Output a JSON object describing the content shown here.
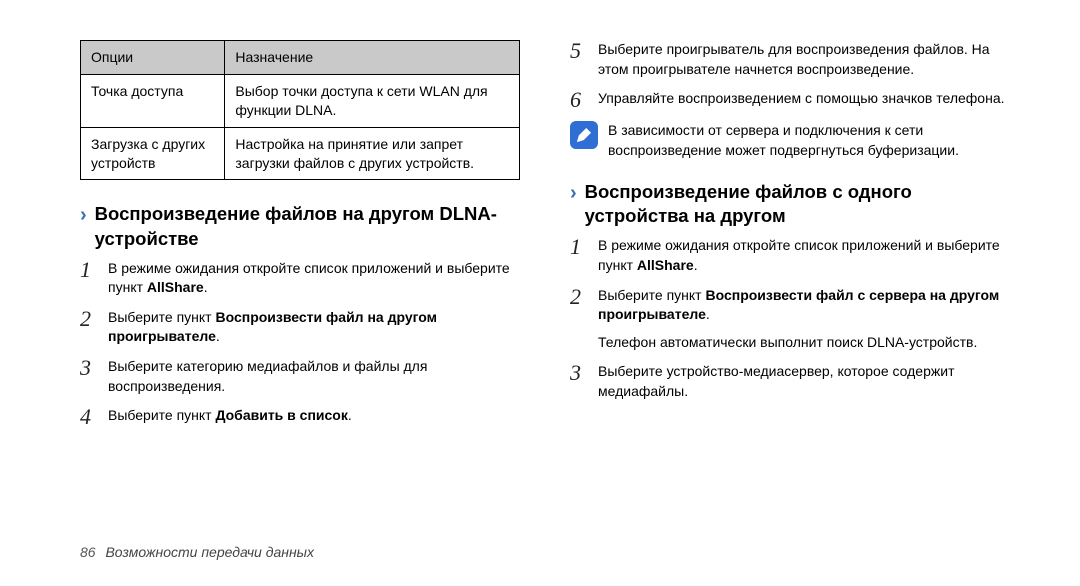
{
  "table": {
    "headers": {
      "opt": "Опции",
      "purpose": "Назначение"
    },
    "rows": [
      {
        "opt": "Точка доступа",
        "purpose": "Выбор точки доступа к сети WLAN для функции DLNA."
      },
      {
        "opt": "Загрузка с других устройств",
        "purpose": "Настройка на принятие или запрет загрузки файлов с других устройств."
      }
    ]
  },
  "left": {
    "heading": "Воспроизведение файлов на другом DLNA-устройстве",
    "steps": {
      "s1a": "В режиме ожидания откройте список приложений и выберите пункт ",
      "s1b": "AllShare",
      "s1c": ".",
      "s2a": "Выберите пункт ",
      "s2b": "Воспроизвести файл на другом проигрывателе",
      "s2c": ".",
      "s3": "Выберите категорию медиафайлов и файлы для воспроизведения.",
      "s4a": "Выберите пункт ",
      "s4b": "Добавить в список",
      "s4c": "."
    }
  },
  "right": {
    "s5": "Выберите проигрыватель для воспроизведения файлов. На этом проигрывателе начнется воспроизведение.",
    "s6": "Управляйте воспроизведением с помощью значков телефона.",
    "note": "В зависимости от сервера и подключения к сети воспроизведение может подвергнуться буферизации.",
    "heading": "Воспроизведение файлов с одного устройства на другом",
    "steps": {
      "s1a": "В режиме ожидания откройте список приложений и выберите пункт ",
      "s1b": "AllShare",
      "s1c": ".",
      "s2a": "Выберите пункт ",
      "s2b": "Воспроизвести файл с сервера на другом проигрывателе",
      "s2c": ".",
      "s2d": "Телефон автоматически выполнит поиск DLNA-устройств.",
      "s3": "Выберите устройство-медиасервер, которое содержит медиафайлы."
    }
  },
  "nums": {
    "n1": "1",
    "n2": "2",
    "n3": "3",
    "n4": "4",
    "n5": "5",
    "n6": "6"
  },
  "footer": {
    "page": "86",
    "text": "Возможности передачи данных"
  }
}
